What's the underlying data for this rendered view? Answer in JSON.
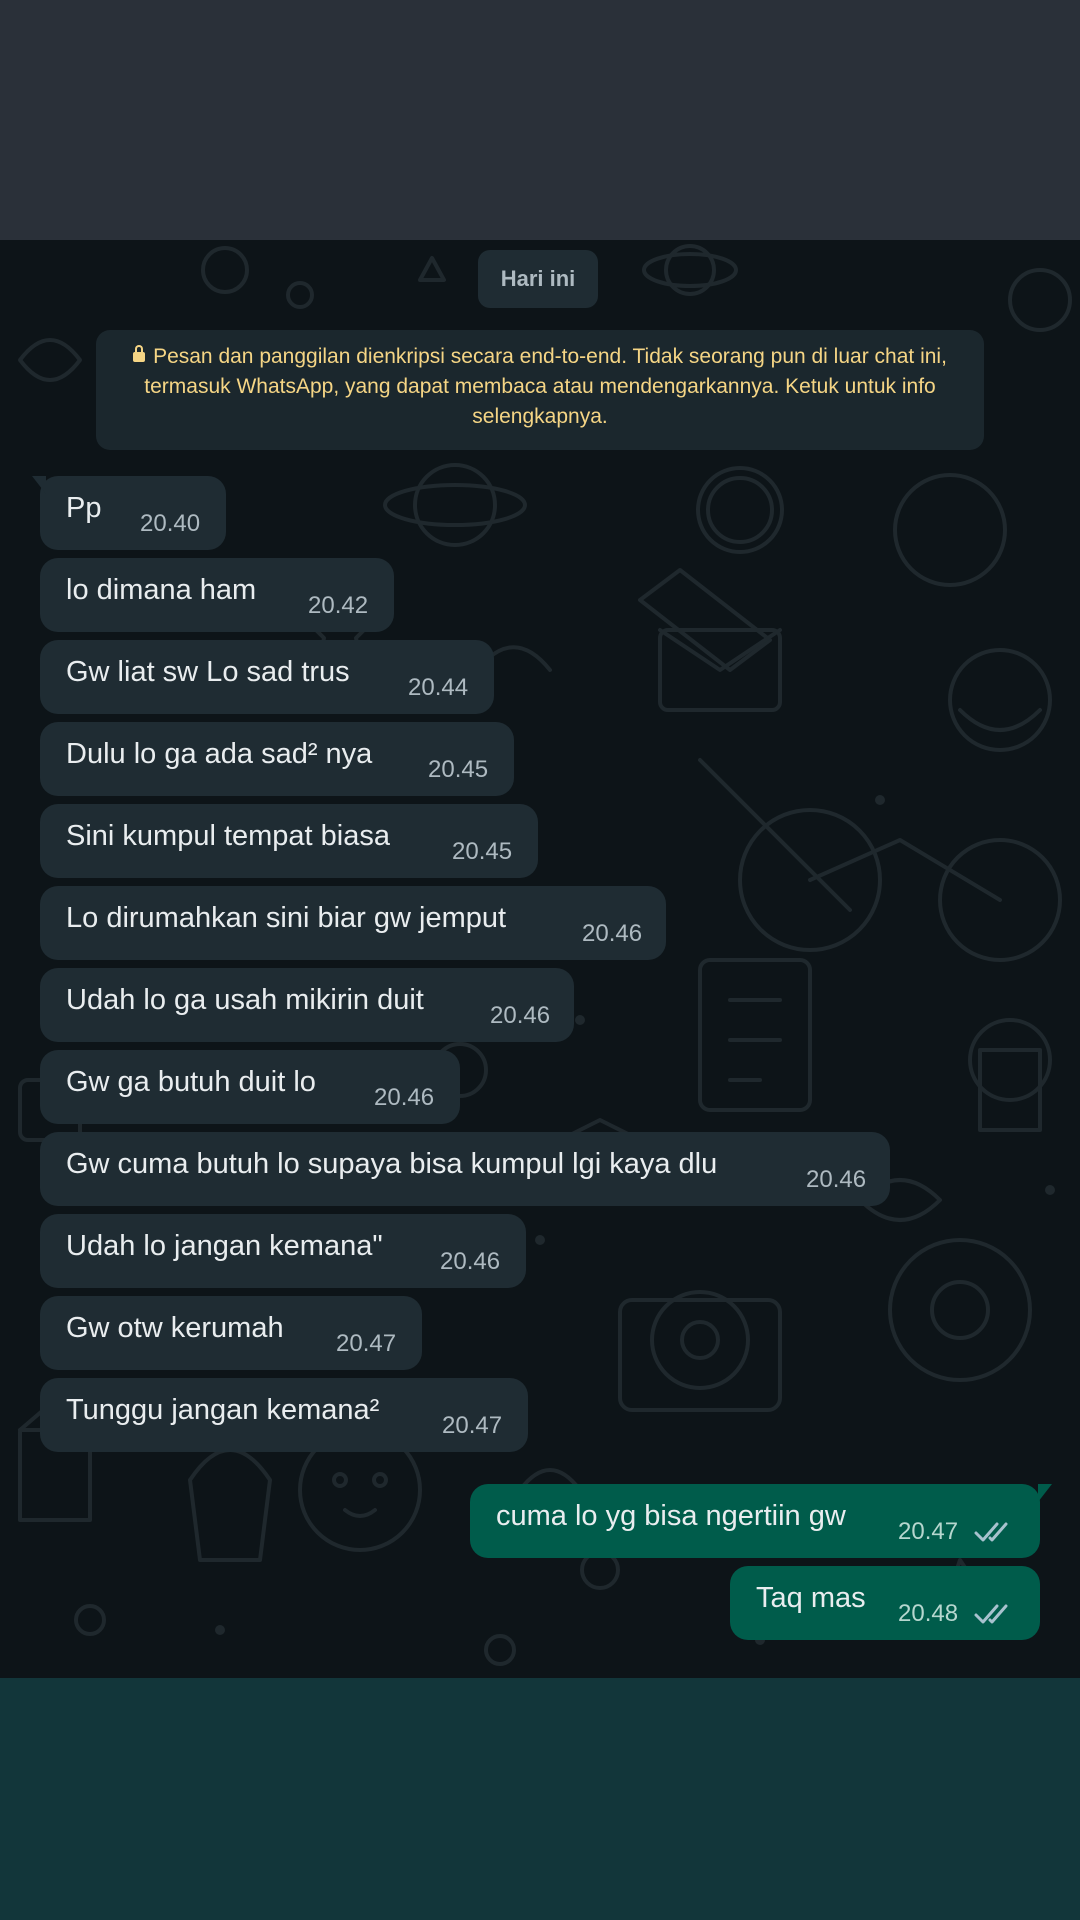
{
  "date_chip": "Hari ini",
  "encryption_notice": "Pesan dan panggilan dienkripsi secara end-to-end. Tidak seorang pun di luar chat ini, termasuk WhatsApp, yang dapat membaca atau mendengarkannya. Ketuk untuk info selengkapnya.",
  "colors": {
    "incoming_bubble": "#1f2c33",
    "outgoing_bubble": "#005c4b",
    "notice_text": "#f5d585",
    "chat_background": "#0d1418"
  },
  "messages": [
    {
      "direction": "in",
      "text": "Pp",
      "time": "20.40"
    },
    {
      "direction": "in",
      "text": "lo dimana ham",
      "time": "20.42"
    },
    {
      "direction": "in",
      "text": "Gw liat sw Lo sad trus",
      "time": "20.44"
    },
    {
      "direction": "in",
      "text": "Dulu lo ga ada sad² nya",
      "time": "20.45"
    },
    {
      "direction": "in",
      "text": "Sini kumpul tempat biasa",
      "time": "20.45"
    },
    {
      "direction": "in",
      "text": "Lo dirumahkan sini biar gw jemput",
      "time": "20.46"
    },
    {
      "direction": "in",
      "text": "Udah lo ga usah mikirin duit",
      "time": "20.46"
    },
    {
      "direction": "in",
      "text": "Gw ga butuh duit lo",
      "time": "20.46"
    },
    {
      "direction": "in",
      "text": "Gw cuma butuh lo supaya bisa kumpul lgi kaya dlu",
      "time": "20.46"
    },
    {
      "direction": "in",
      "text": "Udah lo jangan kemana\"",
      "time": "20.46"
    },
    {
      "direction": "in",
      "text": "Gw otw kerumah",
      "time": "20.47"
    },
    {
      "direction": "in",
      "text": "Tunggu jangan kemana²",
      "time": "20.47"
    },
    {
      "direction": "out",
      "text": "cuma lo yg bisa ngertiin gw",
      "time": "20.47",
      "status": "read"
    },
    {
      "direction": "out",
      "text": "Taq mas",
      "time": "20.48",
      "status": "read"
    }
  ]
}
